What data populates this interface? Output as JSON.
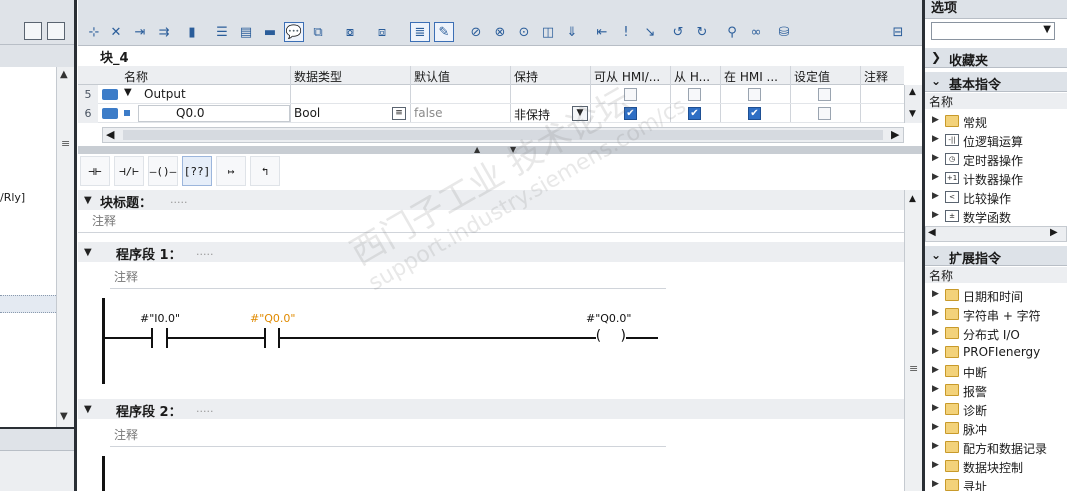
{
  "left_panel": {
    "fragment_text": "/Rly]"
  },
  "interface": {
    "block_title": "块_4",
    "columns": [
      "名称",
      "数据类型",
      "默认值",
      "保持",
      "可从 HMI/...",
      "从 H...",
      "在 HMI ...",
      "设定值",
      "注释"
    ],
    "rows": [
      {
        "num": "5",
        "name": "Output",
        "type": "",
        "default": "",
        "retain": "",
        "hmi1": false,
        "hmi2": false,
        "hmi3": false,
        "setpoint": false
      },
      {
        "num": "6",
        "name": "Q0.0",
        "type": "Bool",
        "default": "false",
        "retain": "非保持",
        "hmi1": true,
        "hmi2": true,
        "hmi3": true,
        "setpoint": false
      }
    ]
  },
  "lad_palette": [
    {
      "icon": "no-contact-icon",
      "glyph": "⊣⊢"
    },
    {
      "icon": "nc-contact-icon",
      "glyph": "⊣/⊢"
    },
    {
      "icon": "coil-icon",
      "glyph": "–()–"
    },
    {
      "icon": "empty-box-icon",
      "glyph": "[??]"
    },
    {
      "icon": "open-branch-icon",
      "glyph": "↦"
    },
    {
      "icon": "close-branch-icon",
      "glyph": "↰"
    }
  ],
  "editor": {
    "block_title_label": "块标题：",
    "block_title_dots": ".....",
    "block_comment": "注释",
    "networks": [
      {
        "title": "程序段 1：",
        "dots": ".....",
        "comment": "注释",
        "contacts": [
          {
            "operand": "#\"I0.0\"",
            "highlight": false
          },
          {
            "operand": "#\"Q0.0\"",
            "highlight": true
          }
        ],
        "coil": {
          "operand": "#\"Q0.0\""
        }
      },
      {
        "title": "程序段 2：",
        "dots": ".....",
        "comment": "注释"
      }
    ]
  },
  "right_panel": {
    "header": "选项",
    "favorites": "收藏夹",
    "basic": {
      "title": "基本指令",
      "name_col": "名称",
      "items": [
        {
          "label": "常规",
          "icon": "folder-icon"
        },
        {
          "label": "位逻辑运算",
          "icon": "bit-logic-icon",
          "glyph": "-||"
        },
        {
          "label": "定时器操作",
          "icon": "timer-icon",
          "glyph": "◷"
        },
        {
          "label": "计数器操作",
          "icon": "counter-icon",
          "glyph": "+1"
        },
        {
          "label": "比较操作",
          "icon": "compare-icon",
          "glyph": "<"
        },
        {
          "label": "数学函数",
          "icon": "math-icon",
          "glyph": "±"
        }
      ]
    },
    "extended": {
      "title": "扩展指令",
      "name_col": "名称",
      "items": [
        {
          "label": "日期和时间"
        },
        {
          "label": "字符串 + 字符"
        },
        {
          "label": "分布式 I/O"
        },
        {
          "label": "PROFIenergy"
        },
        {
          "label": "中断"
        },
        {
          "label": "报警"
        },
        {
          "label": "诊断"
        },
        {
          "label": "脉冲"
        },
        {
          "label": "配方和数据记录"
        },
        {
          "label": "数据块控制"
        },
        {
          "label": "寻址"
        }
      ]
    }
  },
  "watermark": {
    "cn": "西门子工业  技术论坛",
    "en": "support.industry.siemens.com/cs"
  },
  "colors": {
    "accent": "#2f6fc4",
    "highlight_operand": "#e08a00",
    "band": "#eceef1"
  }
}
